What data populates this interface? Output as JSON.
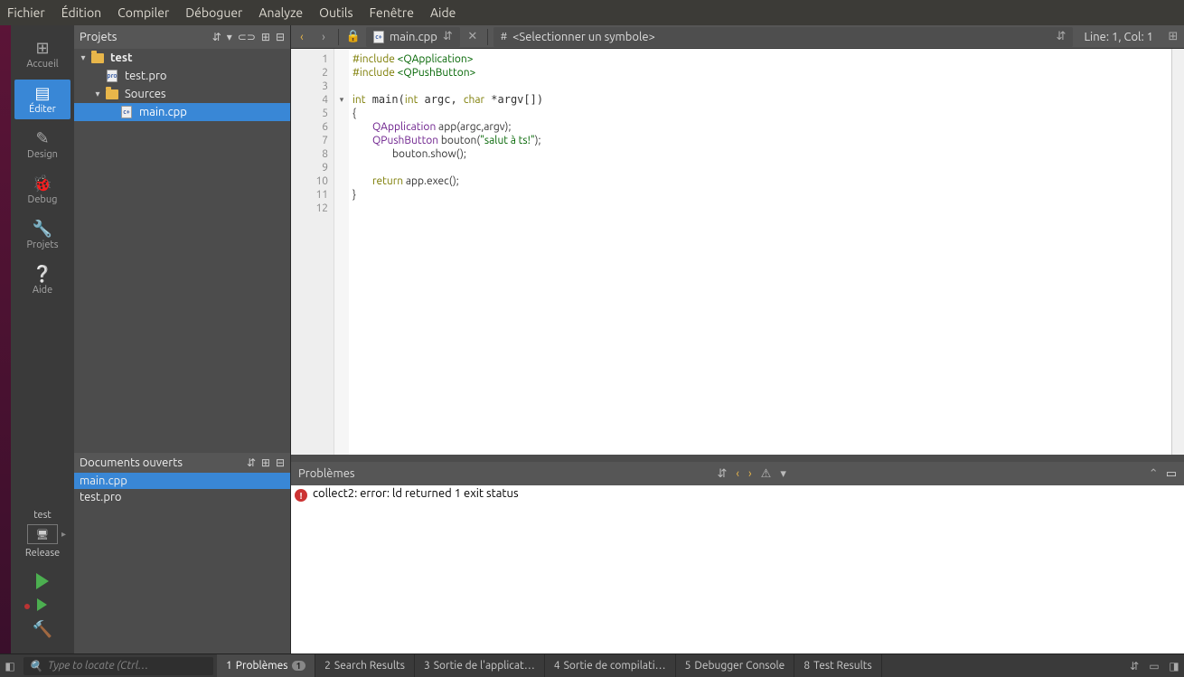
{
  "menu": {
    "items": [
      "Fichier",
      "Édition",
      "Compiler",
      "Déboguer",
      "Analyze",
      "Outils",
      "Fenêtre",
      "Aide"
    ]
  },
  "modebar": {
    "accueil": "Accueil",
    "editer": "Éditer",
    "design": "Design",
    "debug": "Debug",
    "projets": "Projets",
    "aide": "Aide",
    "kit_name": "test",
    "kit_mode": "Release"
  },
  "projects_panel": {
    "title": "Projets",
    "tree": {
      "root": "test",
      "file1": "test.pro",
      "folder": "Sources",
      "file2": "main.cpp"
    }
  },
  "open_docs": {
    "title": "Documents ouverts",
    "items": [
      "main.cpp",
      "test.pro"
    ]
  },
  "toolbar": {
    "file_crumb": "main.cpp",
    "symbol_crumb": "<Selectionner un symbole>",
    "hash": "#",
    "cursor": "Line: 1, Col: 1"
  },
  "code": {
    "lines": 12,
    "l1a": "#include ",
    "l1b": "<QApplication>",
    "l2a": "#include ",
    "l2b": "<QPushButton>",
    "l4": "int main(int argc, char *argv[])",
    "l5": "{",
    "l6a": "        QApplication",
    "l6b": " app(argc,argv);",
    "l7a": "        QPushButton",
    "l7b": " bouton(",
    "l7c": "\"salut à ts!\"",
    "l7d": ");",
    "l8": "                bouton.show();",
    "l10a": "        return",
    "l10b": " app.exec();",
    "l11": "}"
  },
  "problems": {
    "title": "Problèmes",
    "error": "collect2: error: ld returned 1 exit status"
  },
  "bottom": {
    "locator": "Type to locate (Ctrl…",
    "tabs": [
      {
        "n": "1",
        "l": "Problèmes",
        "badge": "1"
      },
      {
        "n": "2",
        "l": "Search Results"
      },
      {
        "n": "3",
        "l": "Sortie de l'applicat…"
      },
      {
        "n": "4",
        "l": "Sortie de compilati…"
      },
      {
        "n": "5",
        "l": "Debugger Console"
      },
      {
        "n": "8",
        "l": "Test Results"
      }
    ]
  }
}
